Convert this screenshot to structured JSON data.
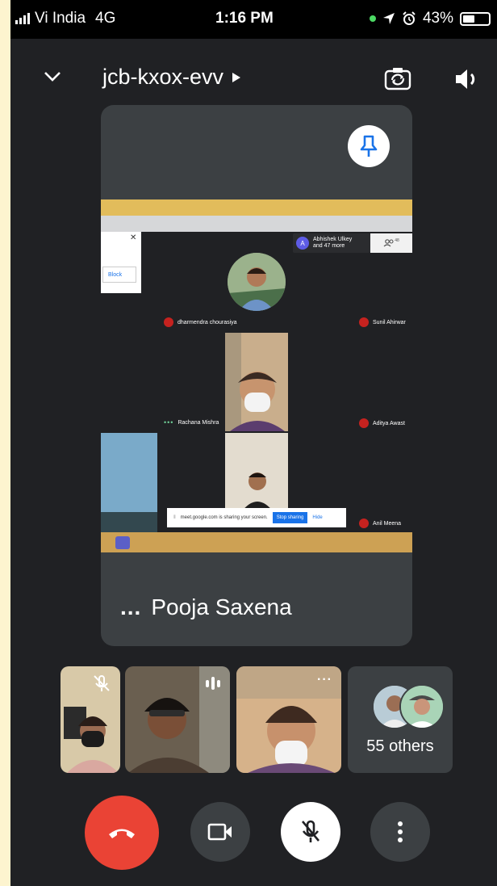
{
  "status_bar": {
    "carrier": "Vi India",
    "network": "4G",
    "time": "1:16 PM",
    "battery": "43%"
  },
  "header": {
    "meeting_code": "jcb-kxox-evv",
    "icons": [
      "chevron-down-icon",
      "play-arrow-icon",
      "switch-camera-icon",
      "speaker-icon"
    ]
  },
  "main_tile": {
    "presenter_name": "Pooja Saxena",
    "pin_icon": "pin-icon",
    "shared_screen": {
      "block_button": "Block",
      "participants_popup": {
        "avatar_letter": "A",
        "line1": "Abhishek Ulkey",
        "line2": "and 47 more",
        "count": "48"
      },
      "tiles": [
        {
          "name": "dharmendra chourasiya"
        },
        {
          "name": "Sunil Ahirwar"
        },
        {
          "name": "Rachana Mishra"
        },
        {
          "name": "Aditya Awast"
        },
        {
          "name": "Anil Meena"
        }
      ],
      "share_banner": {
        "message": "meet.google.com is sharing your screen.",
        "stop_label": "Stop sharing",
        "hide_label": "Hide"
      }
    }
  },
  "participants_strip": {
    "others_label": "55 others"
  },
  "controls": {
    "colors": {
      "end_call": "#ea4335",
      "neutral": "#3c4043",
      "mic_active_bg": "#ffffff"
    }
  }
}
